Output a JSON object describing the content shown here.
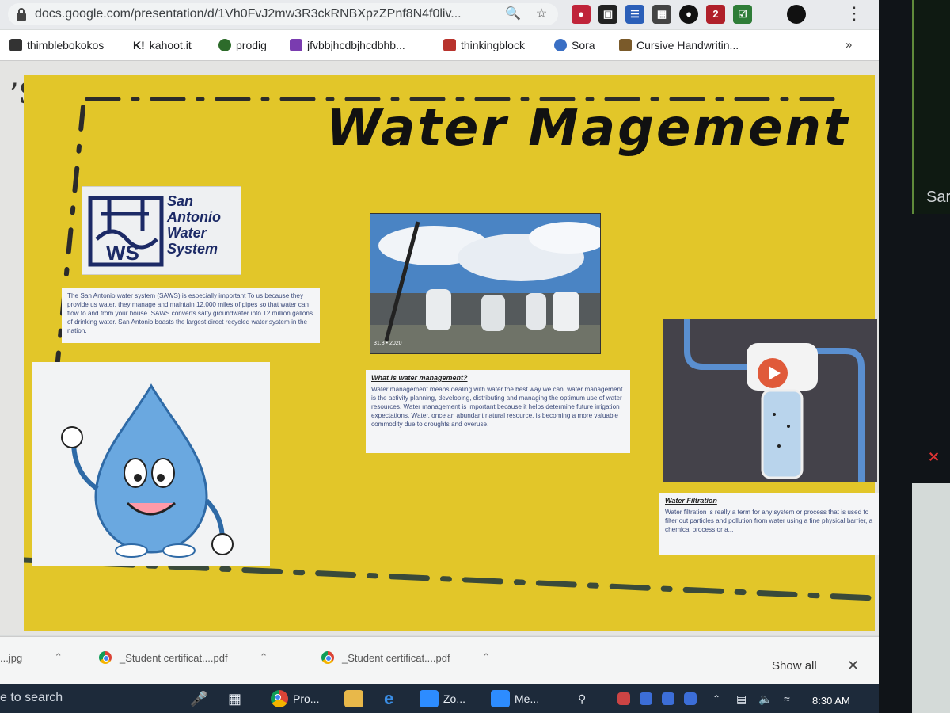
{
  "browser": {
    "url": "docs.google.com/presentation/d/1Vh0FvJ2mw3R3ckRNBXpzZPnf8N4f0liv...",
    "bookmarks": [
      {
        "label": "thimblebokokos",
        "color": "#333333"
      },
      {
        "label": "kahoot.it",
        "color": "#222222",
        "prefix": "K!"
      },
      {
        "label": "prodig",
        "color": "#2d6b2a"
      },
      {
        "label": "jfvbbjhcdbjhcdbhb...",
        "color": "#7a3cb0"
      },
      {
        "label": "thinkingblock",
        "color": "#b8332d"
      },
      {
        "label": "Sora",
        "color": "#3a6fc4"
      },
      {
        "label": "Cursive Handwritin...",
        "color": "#7a5a2a"
      }
    ],
    "more_bookmarks": "»"
  },
  "slide": {
    "title": "Water Magement",
    "saws_logo_text": [
      "San",
      "Antonio",
      "Water",
      "System"
    ],
    "saws_paragraph": "The San Antonio water system (SAWS) is especially important To us because they provide us water, they manage and maintain 12,000 miles of pipes so that water can flow to and from your house. SAWS converts salty groundwater into 12 million gallons of drinking water. San Antonio boasts the largest direct recycled water system in the nation.",
    "photo_stamp": "31.8 • 2020",
    "water_mgmt_title": "What is water management?",
    "water_mgmt_text": "Water management means dealing with water the best way we can. water management is the activity planning, developing, distributing and managing the optimum use of water resources. Water management is important because it helps determine future irrigation expectations. Water, once an abundant natural resource, is becoming a more valuable commodity due to droughts and overuse.",
    "filtration_title": "Water Filtration",
    "filtration_text": "Water filtration is really a term for any system or process that is used to filter out particles and pollution from water using a fine physical barrier, a chemical process or a..."
  },
  "downloads": {
    "items": [
      {
        "label": "...jpg"
      },
      {
        "label": "_Student certificat....pdf"
      },
      {
        "label": "_Student certificat....pdf"
      }
    ],
    "show_all": "Show all"
  },
  "taskbar": {
    "search": "e to search",
    "apps": [
      {
        "label": "Pro...",
        "color": "#e8453c"
      },
      {
        "label": "Zo...",
        "color": "#2d8cff"
      },
      {
        "label": "Me...",
        "color": "#2d8cff"
      }
    ],
    "time": "8:30 AM"
  },
  "side_window": {
    "name_fragment": "Sar"
  }
}
